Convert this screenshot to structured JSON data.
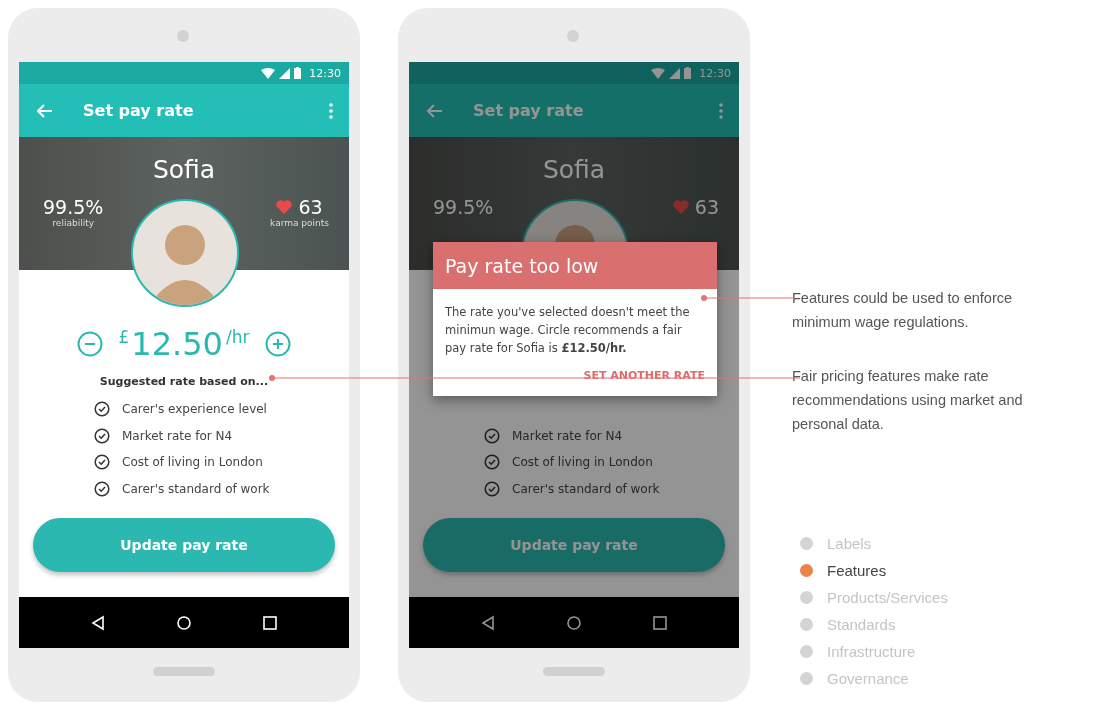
{
  "phones": [
    {
      "kind": "plain",
      "status_time": "12:30",
      "title": "Set pay rate",
      "name": "Sofia",
      "reliability": {
        "value": "99.5%",
        "label": "reliability"
      },
      "karma": {
        "value": "63",
        "label": "karma points"
      },
      "rate": {
        "currency": "£",
        "amount": "12.50",
        "unit": "/hr"
      },
      "suggested_heading": "Suggested rate based on...",
      "criteria": [
        "Carer's experience level",
        "Market rate for N4",
        "Cost of living in London",
        "Carer's standard of work"
      ],
      "button": "Update pay rate"
    },
    {
      "kind": "dialog",
      "status_time": "12:30",
      "title": "Set pay rate",
      "name": "Sofia",
      "reliability": {
        "value": "99.5%"
      },
      "karma": {
        "value": "63"
      },
      "criteria": [
        "Market rate for N4",
        "Cost of living in London",
        "Carer's standard of work"
      ],
      "button": "Update pay rate",
      "dialog": {
        "title": "Pay rate too low",
        "body": "The rate you've selected doesn't meet the minimun wage. Circle recommends a fair pay rate for Sofia is **£12.50/hr.**",
        "action": "SET ANOTHER RATE"
      }
    }
  ],
  "annotations": [
    "Features could be used to enforce minimum wage regulations.",
    "Fair pricing features make rate recommendations using market and personal data."
  ],
  "legend": [
    {
      "label": "Labels",
      "selected": false,
      "color": "#d4d4d4"
    },
    {
      "label": "Features",
      "selected": true,
      "color": "#e8834a"
    },
    {
      "label": "Products/Services",
      "selected": false,
      "color": "#d4d4d4"
    },
    {
      "label": "Standards",
      "selected": false,
      "color": "#d4d4d4"
    },
    {
      "label": "Infrastructure",
      "selected": false,
      "color": "#d4d4d4"
    },
    {
      "label": "Governance",
      "selected": false,
      "color": "#d4d4d4"
    }
  ]
}
